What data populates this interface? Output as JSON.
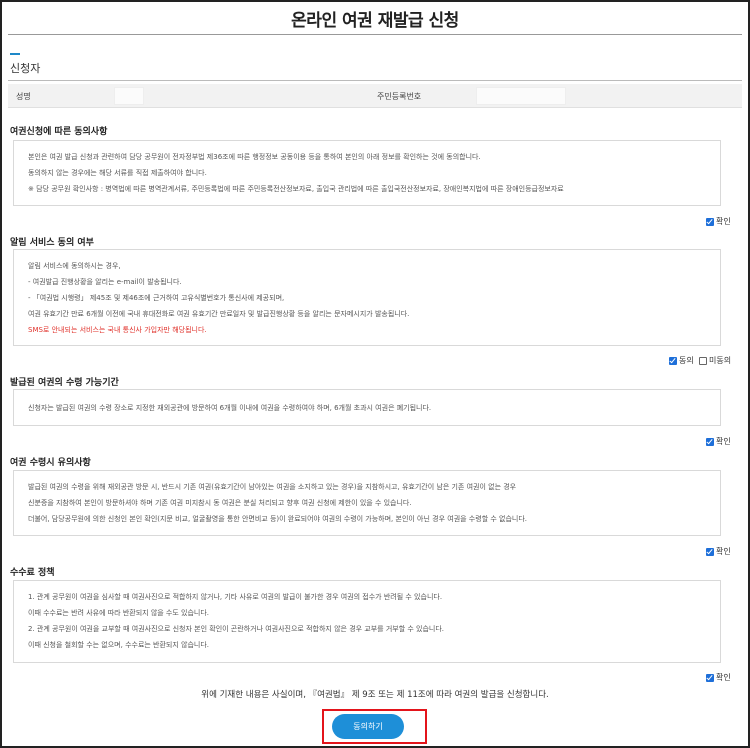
{
  "page": {
    "title": "온라인 여권 재발급 신청"
  },
  "applicant": {
    "heading": "신청자",
    "name_label": "성명",
    "rrn_label": "주민등록번호"
  },
  "consent_info": {
    "heading": "여권신청에 따른 동의사항",
    "lines": [
      "본인은 여권 발급 신청과 관련하여 담당 공무원이 전자정부법 제36조에 따른 행정정보 공동이용 등을 통하여 본인의 아래 정보를 확인하는 것에 동의합니다.",
      "동의하지 않는 경우에는 해당 서류를 직접 제출하여야 합니다.",
      "※ 담당 공무원 확인사항 : 병역법에 따른 병역관계서류, 주민등록법에 따른 주민등록전산정보자료, 출입국 관리법에 따른 출입국전산정보자료, 장애인복지법에 따른 장애인등급정보자료"
    ],
    "check_label": "확인"
  },
  "sms_consent": {
    "heading": "알림 서비스 동의 여부",
    "lines": [
      "알림 서비스에 동의하시는 경우,",
      "- 여권발급 진행상황을 알리는 e-mail이 발송됩니다.",
      "- 「여권법 시행령」 제45조 및 제46조에 근거하여 고유식별번호가 통신사에 제공되며,",
      "여권 유효기간 만료 6개월 이전에 국내 휴대전화로 여권 유효기간 만료일자 및 발급진행상황 등을 알리는 문자메시지가 발송됩니다."
    ],
    "red_line": "SMS로 안내되는 서비스는 국내 통신사 가입자만 해당됩니다.",
    "agree_label": "동의",
    "disagree_label": "미동의"
  },
  "pickup_period": {
    "heading": "발급된 여권의 수령 가능기간",
    "lines": [
      "신청자는 발급된 여권의 수령 장소로 지정한 재외공관에 방문하여 6개월 이내에 여권을 수령하여야 하며, 6개월 초과시 여권은 폐기됩니다."
    ],
    "check_label": "확인"
  },
  "pickup_notes": {
    "heading": "여권 수령시 유의사항",
    "lines": [
      "발급된 여권의 수령을 위해 재외공관 방문 시, 반드시 기존 여권(유효기간이 남아있는 여권을 소지하고 있는 경우)을 지참하시고, 유효기간이 남은 기존 여권이 없는 경우",
      "신분증을 지참하여 본인이 방문하셔야 하며 기존 여권 미지참시 동 여권은 분실 처리되고 향후 여권 신청에 제한이 있을 수 있습니다.",
      "더불어, 담당공무원에 의한 신청인 본인 확인(지문 비교, 얼굴촬영을 통한 안면비교 등)이 완료되어야 여권의 수령이 가능하며, 본인이 아닌 경우 여권을 수령할 수 없습니다."
    ],
    "check_label": "확인"
  },
  "fee_policy": {
    "heading": "수수료 정책",
    "lines": [
      "1. 관계 공무원이 여권을 심사할 때 여권사진으로 적합하지 않거나, 기타 사유로 여권의 발급이 불가한 경우 여권의 접수가 반려될 수 있습니다.",
      "이때 수수료는 반려 사유에 따라 반환되지 않을 수도 있습니다.",
      "2. 관계 공무원이 여권을 교부할 때 여권사진으로 신청자 본인 확인이 곤란하거나 여권사진으로 적합하지 않은 경우 교부를 거부할 수 있습니다.",
      "이때 신청을 철회할 수는 없으며, 수수료는 반환되지 않습니다."
    ],
    "check_label": "확인"
  },
  "footer": {
    "statement": "위에 기재한 내용은 사실이며, 『여권법』 제 9조 또는 제 11조에 따라 여권의 발급을 신청합니다.",
    "agree_button": "동의하기"
  },
  "colors": {
    "accent": "#1e8fd8",
    "checkbox": "#1e6fd9",
    "highlight": "#e3141b",
    "warning": "#e0322b"
  }
}
